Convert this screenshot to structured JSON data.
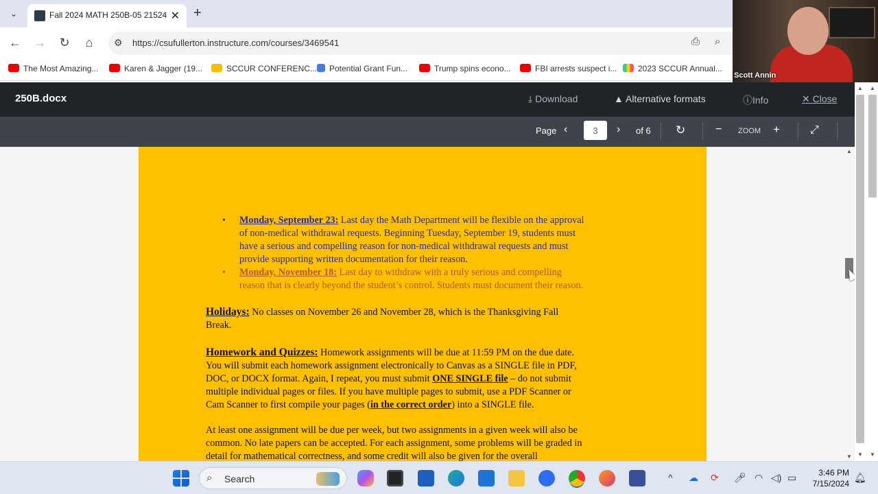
{
  "browser": {
    "tab_title": "Fall 2024 MATH 250B-05 21524",
    "url": "https://csufullerton.instructure.com/courses/3469541",
    "bookmarks": [
      {
        "label": "The Most Amazing...",
        "icon": "youtube-icon"
      },
      {
        "label": "Karen & Jagger (19...",
        "icon": "youtube-icon"
      },
      {
        "label": "SCCUR CONFERENC...",
        "icon": "folder-icon"
      },
      {
        "label": "Potential Grant Fun...",
        "icon": "docs-icon"
      },
      {
        "label": "Trump spins econo...",
        "icon": "youtube-icon"
      },
      {
        "label": "FBI arrests suspect i...",
        "icon": "youtube-icon"
      },
      {
        "label": "2023 SCCUR Annual...",
        "icon": "colorful-app-icon"
      }
    ]
  },
  "video": {
    "participant_name": "Scott Annin"
  },
  "viewer": {
    "file_name": "250B.docx",
    "download_label": "Download",
    "alt_formats_label": "Alternative formats",
    "info_label": "Info",
    "close_label": "Close",
    "page_label": "Page",
    "current_page": "3",
    "of_pages": "of 6",
    "zoom_label": "ZOOM"
  },
  "document": {
    "bullet1_date": "Monday, September 23:",
    "bullet1_lines": [
      " Last day the Math Department will be flexible on the approval",
      "of non-medical withdrawal requests.  Beginning Tuesday, September 19, students must",
      "have a serious and compelling reason for non-medical withdrawal requests and must",
      "provide supporting written documentation for their reason."
    ],
    "bullet2_date": "Monday, November 18:",
    "bullet2_lines": [
      " Last day to withdraw with a truly serious and compelling",
      "reason that is clearly beyond the student’s control.  Students must document their reason."
    ],
    "holidays_head": "Holidays:",
    "holidays_lines": [
      " No classes on November 26 and November 28, which is the Thanksgiving Fall",
      "Break."
    ],
    "hw_head": "Homework and Quizzes:",
    "hw_line1": " Homework assignments will be due at 11:59 PM on the due date.",
    "hw_line2": "You will submit each homework assignment electronically to Canvas as a SINGLE file in PDF,",
    "hw_line3_a": "DOC, or DOCX format.  Again, I repeat, you must submit ",
    "hw_line3_b": "ONE SINGLE file",
    "hw_line3_c": " – do not submit",
    "hw_line4": "multiple individual pages or files.  If you have multiple pages to submit, use a PDF Scanner or",
    "hw_line5_a": "Cam Scanner to first compile your pages (",
    "hw_line5_b": "in the correct order",
    "hw_line5_c": ") into a SINGLE file.",
    "para_lines": [
      "At least one assignment will be due per week, but two assignments in a given week will also be",
      "common. No late papers can be accepted. For each assignment, some problems will be graded in",
      "detail for mathematical correctness, and some credit will also be given for the overall"
    ]
  },
  "taskbar": {
    "search_label": "Search",
    "time": "3:46 PM",
    "date": "7/15/2024"
  },
  "colors": {
    "page_background": "#ffc000",
    "viewer_header": "#1f2428",
    "page_toolbar": "#3e4449",
    "bullet1_text": "#2b2b9b",
    "bullet2_text": "#b45a2a"
  }
}
